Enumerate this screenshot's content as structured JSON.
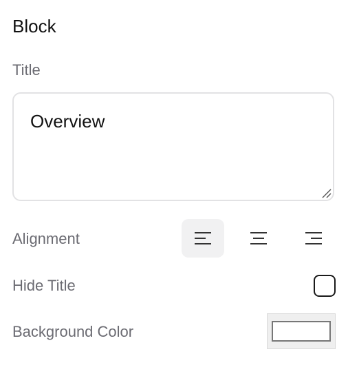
{
  "block": {
    "heading": "Block",
    "title_label": "Title",
    "title_value": "Overview",
    "alignment_label": "Alignment",
    "alignment_options": [
      "align-left",
      "align-center",
      "align-right"
    ],
    "alignment_selected": "align-left",
    "hide_title_label": "Hide Title",
    "hide_title_checked": false,
    "background_color_label": "Background Color",
    "background_color_value": "#ffffff"
  }
}
